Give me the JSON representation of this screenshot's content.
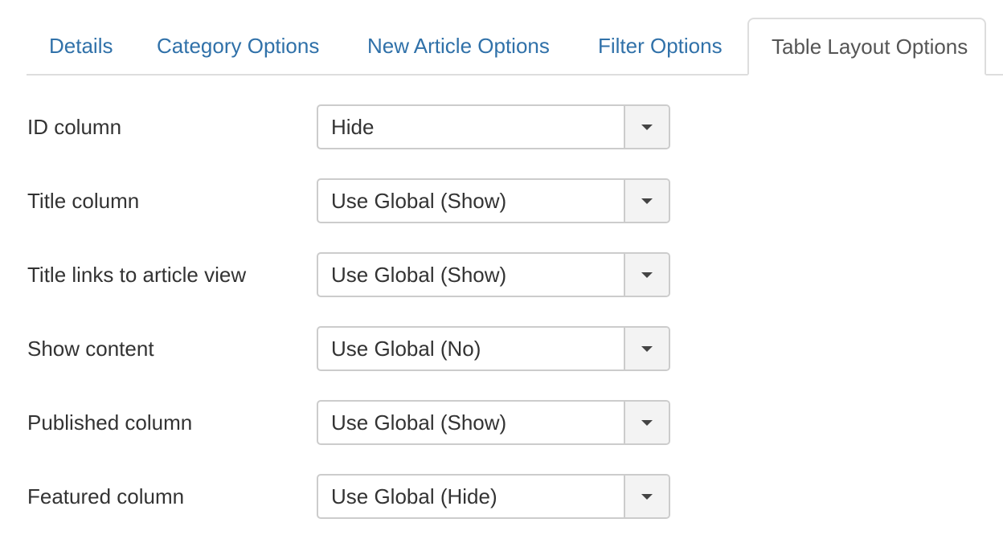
{
  "tabs": [
    {
      "label": "Details",
      "active": false
    },
    {
      "label": "Category Options",
      "active": false
    },
    {
      "label": "New Article Options",
      "active": false
    },
    {
      "label": "Filter Options",
      "active": false
    },
    {
      "label": "Table Layout Options",
      "active": true
    }
  ],
  "fields": [
    {
      "label": "ID column",
      "value": "Hide"
    },
    {
      "label": "Title column",
      "value": "Use Global (Show)"
    },
    {
      "label": "Title links to article view",
      "value": "Use Global (Show)"
    },
    {
      "label": "Show content",
      "value": "Use Global (No)"
    },
    {
      "label": "Published column",
      "value": "Use Global (Show)"
    },
    {
      "label": "Featured column",
      "value": "Use Global (Hide)"
    }
  ],
  "icons": {
    "dropdown": "caret-down-icon"
  },
  "colors": {
    "tab_link": "#3071a9",
    "tab_active_text": "#555555",
    "border": "#cccccc",
    "arrow_bg": "#f3f3f3"
  }
}
